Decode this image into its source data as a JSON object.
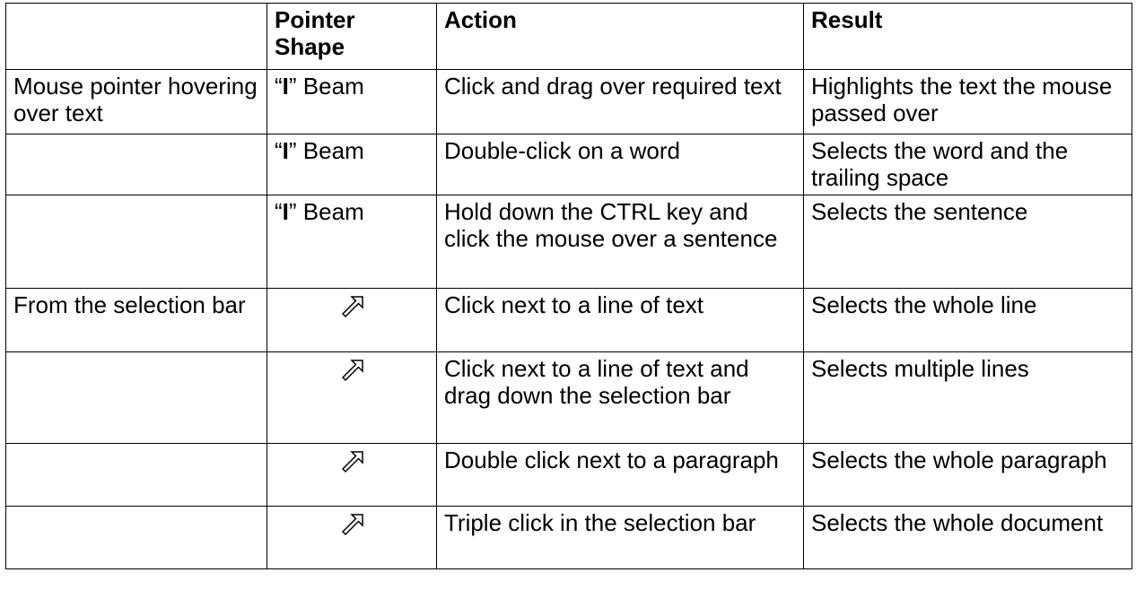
{
  "table": {
    "headers": [
      "",
      "Pointer Shape",
      "Action",
      "Result"
    ],
    "rows": [
      {
        "location": "Mouse pointer hovering over text",
        "pointer": {
          "open_quote": "“",
          "letter": "I",
          "close_quote": "”",
          "word": " Beam"
        },
        "action": "Click and drag over required text",
        "result": "Highlights the text the mouse passed over"
      },
      {
        "location": "",
        "pointer": {
          "open_quote": "“",
          "letter": "I",
          "close_quote": "”",
          "word": " Beam"
        },
        "action": "Double-click on a word",
        "result": "Selects the word and the trailing space"
      },
      {
        "location": "",
        "pointer": {
          "open_quote": "“",
          "letter": "I",
          "close_quote": "”",
          "word": " Beam"
        },
        "action": "Hold down the CTRL key and click the mouse over a sentence",
        "result": "Selects the sentence"
      },
      {
        "location": "From the selection bar",
        "pointer_icon": "selection-arrow-icon",
        "action": "Click next to a line of text",
        "result": "Selects the whole line"
      },
      {
        "location": "",
        "pointer_icon": "selection-arrow-icon",
        "action": "Click next to a line of text and drag down the selection bar",
        "result": "Selects multiple lines"
      },
      {
        "location": "",
        "pointer_icon": "selection-arrow-icon",
        "action": "Double click next to a paragraph",
        "result": "Selects the whole paragraph"
      },
      {
        "location": "",
        "pointer_icon": "selection-arrow-icon",
        "action": "Triple click in the selection bar",
        "result": "Selects the whole document"
      }
    ]
  }
}
